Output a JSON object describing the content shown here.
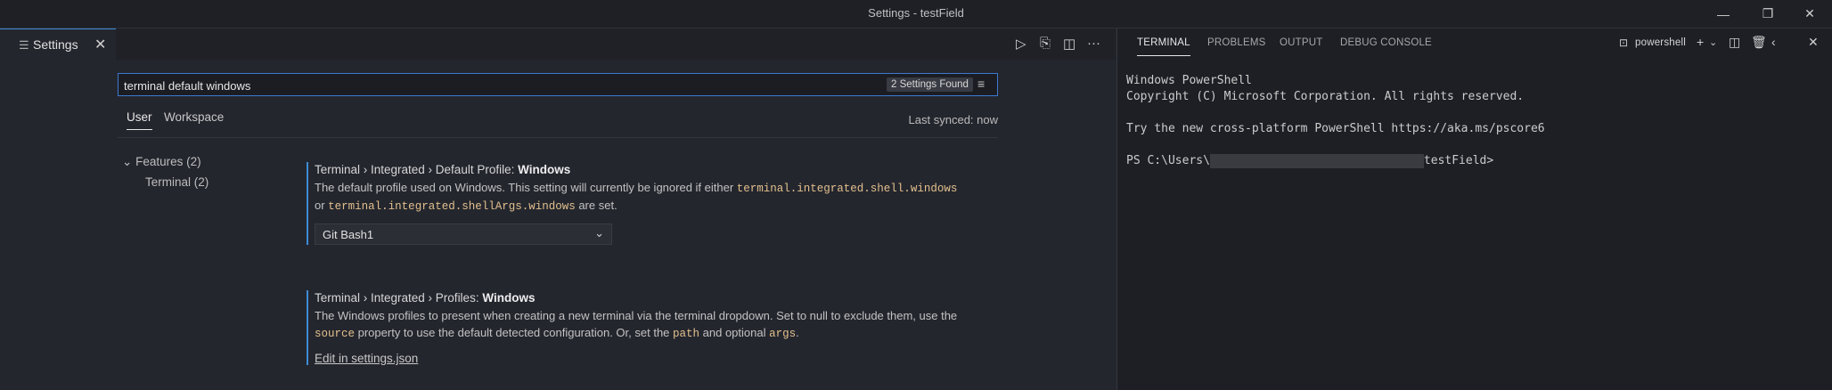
{
  "window": {
    "title": "Settings - testField"
  },
  "editor": {
    "tab_label": "Settings",
    "search": {
      "value": "terminal default windows",
      "result_count": "2 Settings Found"
    },
    "scope_tabs": [
      "User",
      "Workspace"
    ],
    "last_synced": "Last synced: now",
    "tree": {
      "features": "Features (2)",
      "terminal": "Terminal (2)"
    },
    "settings": [
      {
        "title_prefix": "Terminal › Integrated › Default Profile: ",
        "title_bold": "Windows",
        "desc_1": "The default profile used on Windows. This setting will currently be ignored if either ",
        "code_1": "terminal.integrated.shell.windows",
        "desc_2": "or ",
        "code_2": "terminal.integrated.shellArgs.windows",
        "desc_3": " are set.",
        "select_value": "Git Bash1"
      },
      {
        "title_prefix": "Terminal › Integrated › Profiles: ",
        "title_bold": "Windows",
        "desc_1": "The Windows profiles to present when creating a new terminal via the terminal dropdown. Set to null to exclude them, use the",
        "code_1": "source",
        "desc_2": " property to use the default detected configuration. Or, set the ",
        "code_2": "path",
        "desc_3": " and optional ",
        "code_3": "args",
        "desc_4": ".",
        "link": "Edit in settings.json"
      }
    ]
  },
  "panel": {
    "tabs": [
      "TERMINAL",
      "PROBLEMS",
      "OUTPUT",
      "DEBUG CONSOLE"
    ],
    "shell_label": "powershell",
    "terminal_lines": [
      "Windows PowerShell",
      "Copyright (C) Microsoft Corporation. All rights reserved.",
      "",
      "Try the new cross-platform PowerShell https://aka.ms/pscore6",
      ""
    ],
    "prompt_prefix": "PS C:\\Users\\",
    "prompt_suffix": "testField>"
  }
}
